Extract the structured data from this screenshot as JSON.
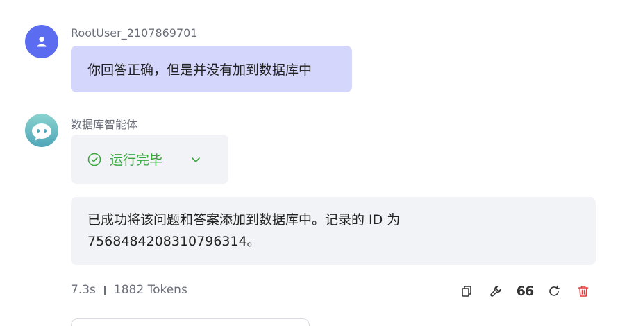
{
  "user": {
    "name": "RootUser_2107869701",
    "message": "你回答正确，但是并没有加到数据库中"
  },
  "agent": {
    "name": "数据库智能体",
    "status_label": "运行完毕",
    "reply_line1": "已成功将该问题和答案添加到数据库中。记录的 ID 为",
    "reply_line2": "7568484208310796314。"
  },
  "meta": {
    "duration": "7.3s",
    "tokens": "1882 Tokens"
  },
  "actions": {
    "quote_label": "66",
    "icons": [
      "copy-icon",
      "wrench-icon",
      "quote-icon",
      "refresh-icon",
      "trash-icon"
    ],
    "delete_color": "#e23b3b"
  },
  "colors": {
    "user_bubble": "#d4d6fb",
    "user_avatar": "#5b6cf0",
    "status_green": "#3aa63f",
    "agent_bubble": "#f2f3f6"
  }
}
